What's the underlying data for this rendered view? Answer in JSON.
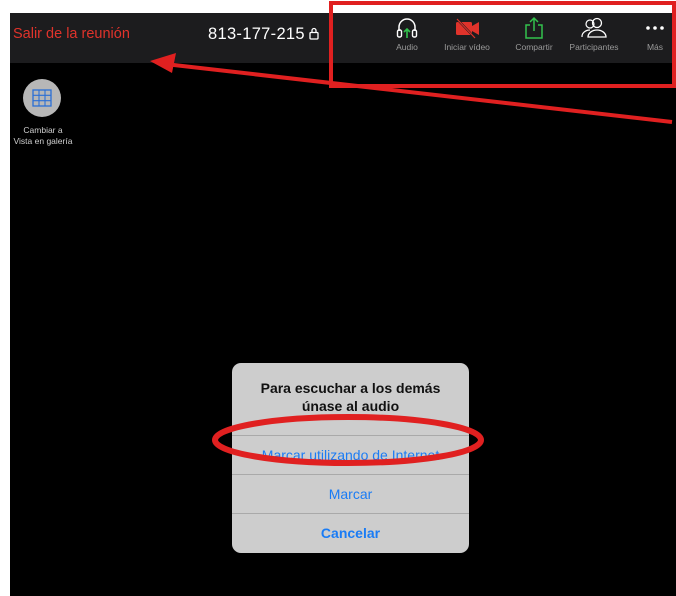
{
  "meeting": {
    "leave_label": "Salir de la reunión",
    "meeting_id": "813-177-215"
  },
  "toolbar": {
    "audio_label": "Audio",
    "video_label": "Iniciar vídeo",
    "share_label": "Compartir",
    "participants_label": "Participantes",
    "more_label": "Más"
  },
  "gallery": {
    "label_line1": "Cambiar a",
    "label_line2": "Vista en galería"
  },
  "dialog": {
    "title_line1": "Para escuchar a los demás",
    "title_line2": "únase al audio",
    "internet_label": "Marcar utilizando de Internet",
    "dial_label": "Marcar",
    "cancel_label": "Cancelar"
  },
  "colors": {
    "leave_red": "#e0332b",
    "audio_green": "#33c24d",
    "video_red": "#e0332b",
    "ios_blue": "#1a7cf5",
    "annotation_red": "#e02020"
  }
}
